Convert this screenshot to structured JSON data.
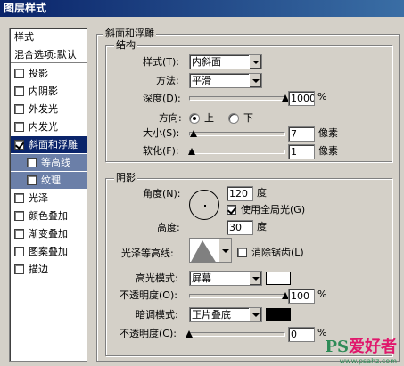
{
  "window": {
    "title": "图层样式"
  },
  "sidebar": {
    "header": "样式",
    "blend_options": "混合选项:默认",
    "items": [
      {
        "label": "投影",
        "checked": false
      },
      {
        "label": "内阴影",
        "checked": false
      },
      {
        "label": "外发光",
        "checked": false
      },
      {
        "label": "内发光",
        "checked": false
      },
      {
        "label": "斜面和浮雕",
        "checked": true
      },
      {
        "label": "等高线",
        "checked": false
      },
      {
        "label": "纹理",
        "checked": false
      },
      {
        "label": "光泽",
        "checked": false
      },
      {
        "label": "颜色叠加",
        "checked": false
      },
      {
        "label": "渐变叠加",
        "checked": false
      },
      {
        "label": "图案叠加",
        "checked": false
      },
      {
        "label": "描边",
        "checked": false
      }
    ]
  },
  "bevel": {
    "title": "斜面和浮雕",
    "structure": {
      "title": "结构",
      "style_label": "样式(T):",
      "style_value": "内斜面",
      "technique_label": "方法:",
      "technique_value": "平滑",
      "depth_label": "深度(D):",
      "depth_value": "1000",
      "depth_level": 1.0,
      "percent": "%",
      "direction_label": "方向:",
      "direction_up": "上",
      "direction_down": "下",
      "size_label": "大小(S):",
      "size_value": "7",
      "size_level": 0.05,
      "size_unit": "像素",
      "soften_label": "软化(F):",
      "soften_value": "1",
      "soften_level": 0.03,
      "soften_unit": "像素"
    },
    "shading": {
      "title": "阴影",
      "angle_label": "角度(N):",
      "angle_value": "120",
      "angle_unit": "度",
      "global_light_label": "使用全局光(G)",
      "altitude_label": "高度:",
      "altitude_value": "30",
      "altitude_unit": "度",
      "gloss_label": "光泽等高线:",
      "antialias_label": "消除锯齿(L)",
      "highlight_label": "高光模式:",
      "highlight_value": "屏幕",
      "highlight_color": "#ffffff",
      "highlight_opacity_label": "不透明度(O):",
      "highlight_opacity_value": "100",
      "highlight_opacity_level": 1.0,
      "shadow_label": "暗调模式:",
      "shadow_value": "正片叠底",
      "shadow_color": "#000000",
      "shadow_opacity_label": "不透明度(C):",
      "shadow_opacity_value": "0",
      "shadow_opacity_level": 0.0
    }
  },
  "watermark": {
    "ps": "PS",
    "text": "爱好者",
    "sub": "www.psahz.com"
  }
}
